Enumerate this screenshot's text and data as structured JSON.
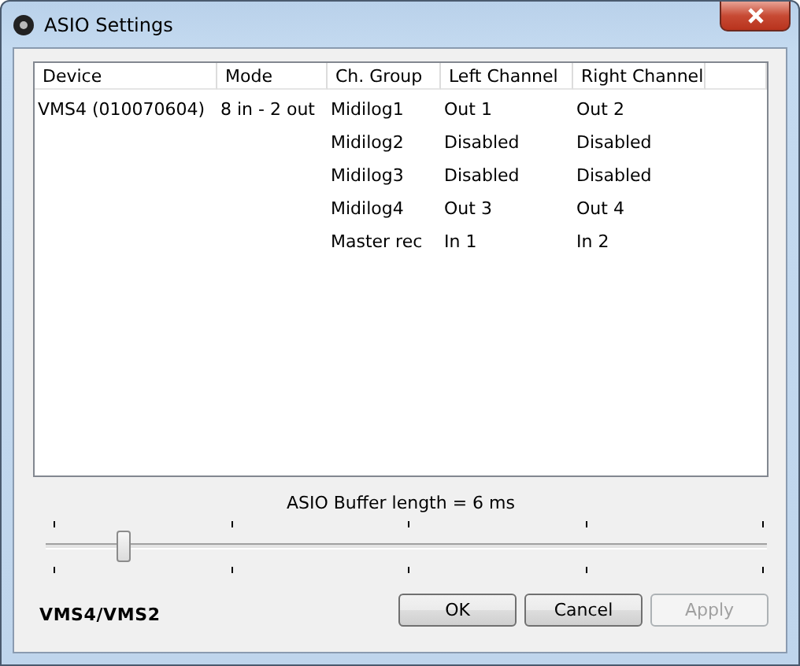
{
  "window": {
    "title": "ASIO Settings"
  },
  "table": {
    "columns": [
      "Device",
      "Mode",
      "Ch. Group",
      "Left Channel",
      "Right Channel"
    ],
    "rows": [
      {
        "device": "VMS4 (010070604)",
        "mode": "8 in - 2 out",
        "ch_group": "Midilog1",
        "left_channel": "Out 1",
        "right_channel": "Out 2"
      },
      {
        "ch_group": "Midilog2",
        "left_channel": "Disabled",
        "right_channel": "Disabled"
      },
      {
        "ch_group": "Midilog3",
        "left_channel": "Disabled",
        "right_channel": "Disabled"
      },
      {
        "ch_group": "Midilog4",
        "left_channel": "Out 3",
        "right_channel": "Out 4"
      },
      {
        "ch_group": "Master rec",
        "left_channel": "In 1",
        "right_channel": "In 2"
      }
    ]
  },
  "buffer": {
    "label": "ASIO Buffer length = 6 ms",
    "level": 0.1
  },
  "brand": "VMS4/VMS2",
  "buttons": [
    {
      "label": "OK",
      "disabled": false
    },
    {
      "label": "Cancel",
      "disabled": false
    },
    {
      "label": "Apply",
      "disabled": true
    }
  ]
}
